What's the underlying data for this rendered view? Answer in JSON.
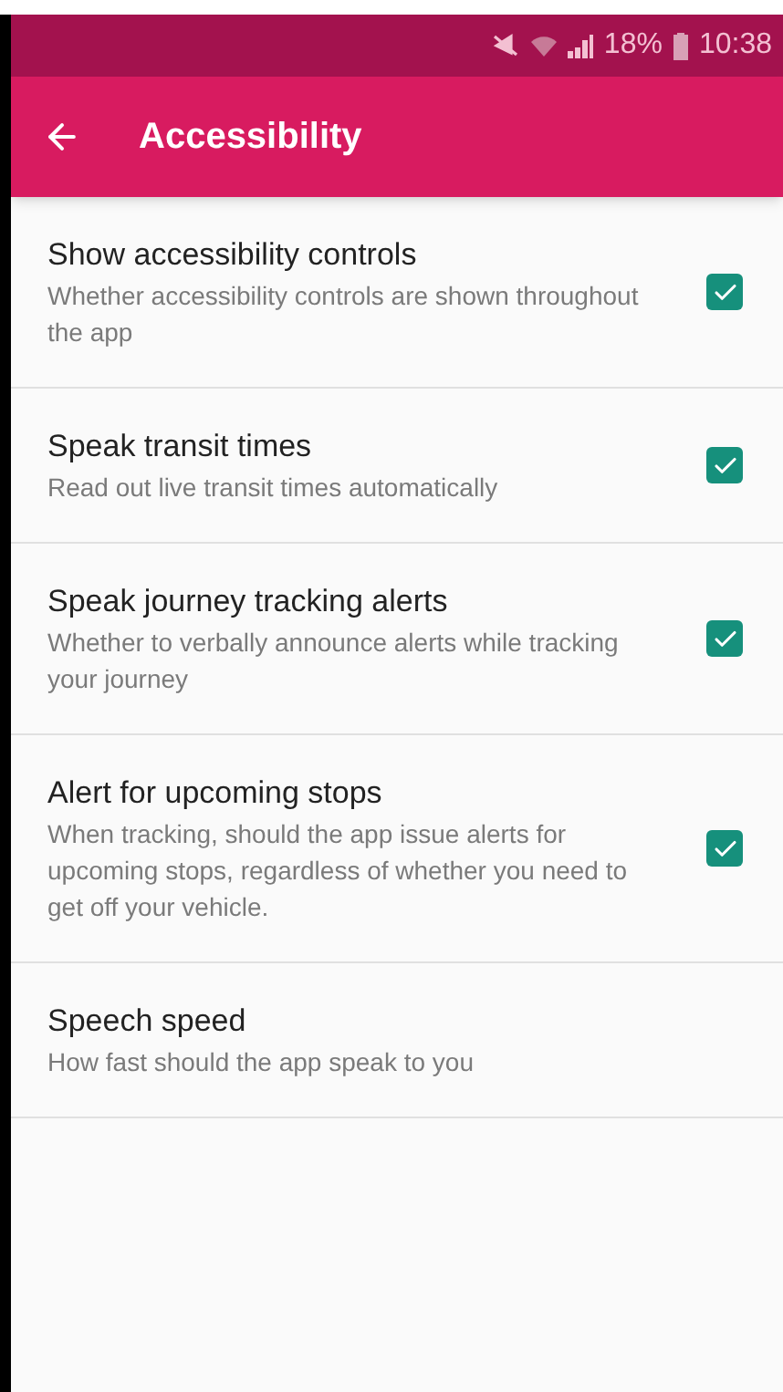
{
  "status_bar": {
    "battery": "18%",
    "time": "10:38"
  },
  "app_bar": {
    "title": "Accessibility"
  },
  "settings": [
    {
      "kind": "checkbox",
      "title": "Show accessibility controls",
      "summary": "Whether accessibility controls are shown throughout the app",
      "checked": true
    },
    {
      "kind": "checkbox",
      "title": "Speak transit times",
      "summary": "Read out live transit times automatically",
      "checked": true
    },
    {
      "kind": "checkbox",
      "title": "Speak journey tracking alerts",
      "summary": "Whether to verbally announce alerts while tracking your journey",
      "checked": true
    },
    {
      "kind": "checkbox",
      "title": "Alert for upcoming stops",
      "summary": "When tracking, should the app issue alerts for upcoming stops, regardless of whether you need to get off your vehicle.",
      "checked": true
    },
    {
      "kind": "plain",
      "title": "Speech speed",
      "summary": "How fast should the app speak to you"
    }
  ]
}
